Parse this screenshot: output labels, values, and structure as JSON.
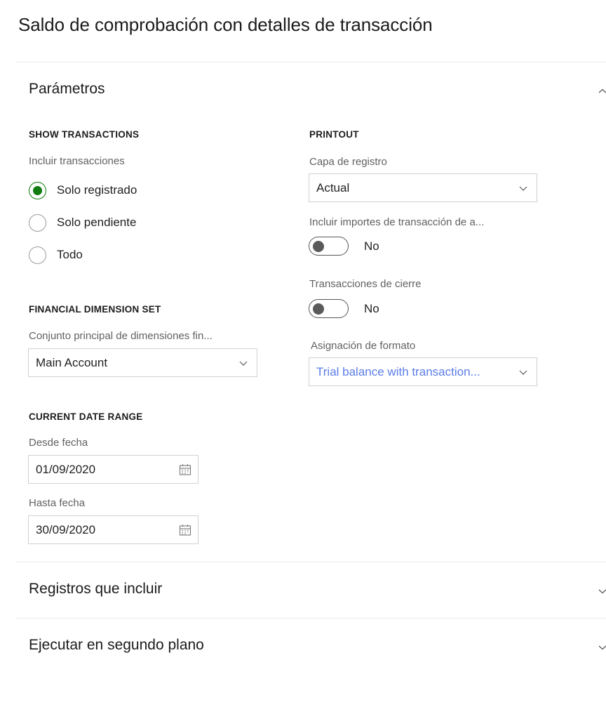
{
  "page": {
    "title": "Saldo de comprobación con detalles de transacción"
  },
  "colors": {
    "accent_green": "#107C10",
    "link_blue": "#5B7CE8",
    "field_border": "#D1D1D1",
    "divider": "#EBEBEB",
    "label_gray": "#616161"
  },
  "sections": [
    {
      "title": "Parámetros",
      "chevron_icon": "chevron-up-icon",
      "expanded": true
    },
    {
      "title": "Registros que incluir",
      "chevron_icon": "chevron-down-icon",
      "expanded": false
    },
    {
      "title": "Ejecutar en segundo plano",
      "chevron_icon": "chevron-down-icon",
      "expanded": false
    }
  ],
  "parameters": {
    "show_transactions": {
      "group_label": "SHOW TRANSACTIONS",
      "field_label": "Incluir transacciones",
      "options": [
        {
          "label": "Solo registrado",
          "selected": true
        },
        {
          "label": "Solo pendiente",
          "selected": false
        },
        {
          "label": "Todo",
          "selected": false
        }
      ]
    },
    "financial_dimension_set": {
      "group_label": "FINANCIAL DIMENSION SET",
      "field_label": "Conjunto principal de dimensiones fin...",
      "value": "Main Account",
      "arrow_icon": "chevron-down-icon"
    },
    "current_date_range": {
      "group_label": "CURRENT DATE RANGE",
      "from": {
        "field_label": "Desde fecha",
        "value": "01/09/2020",
        "icon": "calendar-icon"
      },
      "to": {
        "field_label": "Hasta fecha",
        "value": "30/09/2020",
        "icon": "calendar-icon"
      }
    },
    "printout": {
      "group_label": "PRINTOUT",
      "posting_layer": {
        "field_label": "Capa de registro",
        "value": "Actual",
        "arrow_icon": "chevron-down-icon"
      },
      "include_amounts": {
        "field_label": "Incluir importes de transacción de a...",
        "state_label": "No",
        "on": false
      },
      "closing_transactions": {
        "field_label": "Transacciones de cierre",
        "state_label": "No",
        "on": false
      },
      "format_mapping": {
        "field_label": "Asignación de formato",
        "value": "Trial balance with transaction...",
        "is_link": true,
        "arrow_icon": "chevron-down-icon"
      }
    }
  }
}
